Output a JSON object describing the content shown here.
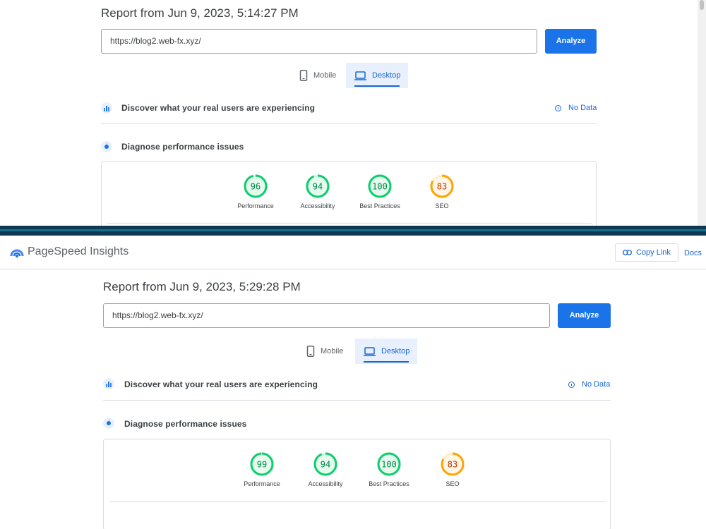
{
  "top": {
    "report_title": "Report from Jun 9, 2023, 5:14:27 PM",
    "url_value": "https://blog2.web-fx.xyz/",
    "analyze_label": "Analyze",
    "tabs": [
      {
        "label": "Mobile"
      },
      {
        "label": "Desktop"
      }
    ],
    "discover_text": "Discover what your real users are experiencing",
    "no_data_label": "No Data",
    "diagnose_text": "Diagnose performance issues",
    "scores": [
      {
        "label": "Performance",
        "value": "96",
        "score": 96,
        "color": "#0cce6b",
        "text_color": "#018642"
      },
      {
        "label": "Accessibility",
        "value": "94",
        "score": 94,
        "color": "#0cce6b",
        "text_color": "#018642"
      },
      {
        "label": "Best Practices",
        "value": "100",
        "score": 100,
        "color": "#0cce6b",
        "text_color": "#018642"
      },
      {
        "label": "SEO",
        "value": "83",
        "score": 83,
        "color": "#ffa400",
        "text_color": "#c33300"
      }
    ]
  },
  "bottom": {
    "app_name": "PageSpeed Insights",
    "copy_link_label": "Copy Link",
    "docs_label": "Docs",
    "report_title": "Report from Jun 9, 2023, 5:29:28 PM",
    "url_value": "https://blog2.web-fx.xyz/",
    "analyze_label": "Analyze",
    "tabs": [
      {
        "label": "Mobile"
      },
      {
        "label": "Desktop"
      }
    ],
    "discover_text": "Discover what your real users are experiencing",
    "no_data_label": "No Data",
    "diagnose_text": "Diagnose performance issues",
    "scores": [
      {
        "label": "Performance",
        "value": "99",
        "score": 99,
        "color": "#0cce6b",
        "text_color": "#018642"
      },
      {
        "label": "Accessibility",
        "value": "94",
        "score": 94,
        "color": "#0cce6b",
        "text_color": "#018642"
      },
      {
        "label": "Best Practices",
        "value": "100",
        "score": 100,
        "color": "#0cce6b",
        "text_color": "#018642"
      },
      {
        "label": "SEO",
        "value": "83",
        "score": 83,
        "color": "#ffa400",
        "text_color": "#c33300"
      }
    ]
  },
  "colors": {
    "accent": "#1a73e8",
    "pass": "#0cce6b",
    "average": "#ffa400"
  },
  "icons": {
    "mobile": "smartphone-icon",
    "desktop": "laptop-icon",
    "discover": "crux-users-icon",
    "diagnose": "lighthouse-icon",
    "info": "info-icon",
    "link": "link-icon",
    "logo": "pagespeed-logo-icon"
  }
}
